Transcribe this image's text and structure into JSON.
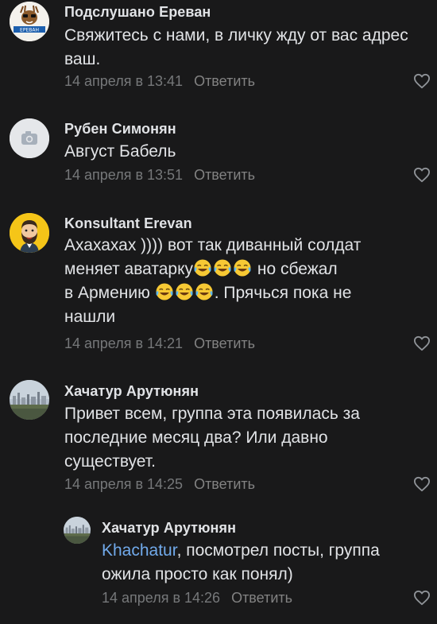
{
  "comments": [
    {
      "author": "Подслушано Ереван",
      "avatar_text": "ЕРЕВАН",
      "text": "Свяжитесь с нами, в личку жду от вас адрес ваш.",
      "date": "14 апреля в 13:41",
      "reply_label": "Ответить"
    },
    {
      "author": "Рубен Симонян",
      "text": "Август Бабель",
      "date": "14 апреля в 13:51",
      "reply_label": "Ответить"
    },
    {
      "author": "Konsultant Erevan",
      "text_line1": "Ахахахах )))) вот так диванный солдат",
      "text_line2_a": "меняет аватарку",
      "text_line2_b": " но сбежал",
      "text_line3_a": "в Армению ",
      "text_line3_b": ". Прячься пока не",
      "text_line4": "нашли",
      "date": "14 апреля в 14:21",
      "reply_label": "Ответить"
    },
    {
      "author": "Хачатур Арутюнян",
      "text": "Привет всем, группа эта появилась за последние месяц два? Или давно существует.",
      "date": "14 апреля в 14:25",
      "reply_label": "Ответить"
    }
  ],
  "reply": {
    "author": "Хачатур Арутюнян",
    "mention": "Khachatur",
    "text": ", посмотрел посты, группа ожила просто как понял)",
    "date": "14 апреля в 14:26",
    "reply_label": "Ответить"
  },
  "colors": {
    "background": "#19191a",
    "text": "#e1e3e6",
    "secondary": "#76787a",
    "link": "#71aaeb"
  }
}
